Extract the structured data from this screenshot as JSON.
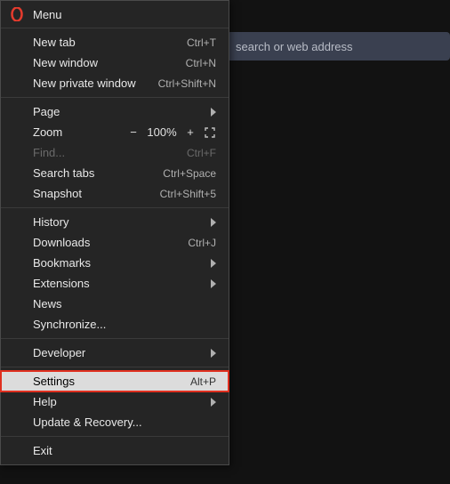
{
  "address_bar": {
    "placeholder": "search or web address"
  },
  "menu": {
    "title": "Menu",
    "items": {
      "new_tab": {
        "label": "New tab",
        "shortcut": "Ctrl+T"
      },
      "new_window": {
        "label": "New window",
        "shortcut": "Ctrl+N"
      },
      "new_private": {
        "label": "New private window",
        "shortcut": "Ctrl+Shift+N"
      },
      "page": {
        "label": "Page"
      },
      "zoom": {
        "label": "Zoom",
        "value": "100%"
      },
      "find": {
        "label": "Find...",
        "shortcut": "Ctrl+F"
      },
      "search_tabs": {
        "label": "Search tabs",
        "shortcut": "Ctrl+Space"
      },
      "snapshot": {
        "label": "Snapshot",
        "shortcut": "Ctrl+Shift+5"
      },
      "history": {
        "label": "History"
      },
      "downloads": {
        "label": "Downloads",
        "shortcut": "Ctrl+J"
      },
      "bookmarks": {
        "label": "Bookmarks"
      },
      "extensions": {
        "label": "Extensions"
      },
      "news": {
        "label": "News"
      },
      "synchronize": {
        "label": "Synchronize..."
      },
      "developer": {
        "label": "Developer"
      },
      "settings": {
        "label": "Settings",
        "shortcut": "Alt+P"
      },
      "help": {
        "label": "Help"
      },
      "update": {
        "label": "Update & Recovery..."
      },
      "exit": {
        "label": "Exit"
      }
    }
  }
}
